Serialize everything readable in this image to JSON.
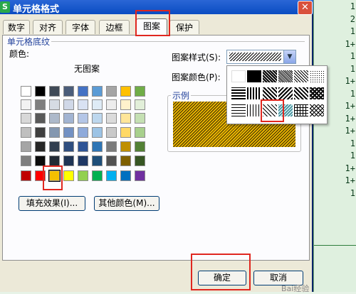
{
  "sheet": {
    "cells": [
      "1",
      "2",
      "1",
      "1+",
      "1",
      "1",
      "1+",
      "1",
      "1+",
      "1+",
      "1+",
      "1",
      "1",
      "1+",
      "1+",
      "1"
    ]
  },
  "dialog": {
    "title": "单元格格式",
    "app_icon": "S"
  },
  "tabs": [
    {
      "label": "数字"
    },
    {
      "label": "对齐"
    },
    {
      "label": "字体"
    },
    {
      "label": "边框"
    },
    {
      "label": "图案",
      "active": true
    },
    {
      "label": "保护"
    }
  ],
  "shading": {
    "group_label": "单元格底纹",
    "color_label": "颜色:",
    "no_pattern_label": "无图案",
    "selected_color": "#f5c000",
    "palette": [
      [
        "#ffffff",
        "#000000",
        "#404a57",
        "#4b5d7a",
        "#4472c4",
        "#5b9bd5",
        "#a5a5a5",
        "#ffc000",
        "#70ad47"
      ],
      [
        "#f2f2f2",
        "#7f7f7f",
        "#d6dce4",
        "#d0d8e8",
        "#d9e2f3",
        "#deebf6",
        "#ededed",
        "#fff2cc",
        "#e2efd9"
      ],
      [
        "#d8d8d8",
        "#595959",
        "#adb9ca",
        "#a2b4d2",
        "#b4c6e7",
        "#bdd7ee",
        "#dbdbdb",
        "#ffe699",
        "#c5e0b3"
      ],
      [
        "#bfbfbf",
        "#3f3f3f",
        "#8497b0",
        "#7391c3",
        "#8eaadb",
        "#9cc3e5",
        "#c9c9c9",
        "#ffd966",
        "#a8d08d"
      ],
      [
        "#a5a5a5",
        "#262626",
        "#323f4f",
        "#2f4e7f",
        "#2f5496",
        "#2e75b5",
        "#7b7b7b",
        "#bf8f00",
        "#538135"
      ],
      [
        "#7f7f7f",
        "#0c0c0c",
        "#222a35",
        "#1f3454",
        "#1f3864",
        "#1e4e79",
        "#525252",
        "#7f6000",
        "#375623"
      ],
      [
        "#c00000",
        "#ff0000",
        "#f5c000",
        "#ffff00",
        "#92d050",
        "#00b050",
        "#00b0f0",
        "#0070c0",
        "#7030a0"
      ]
    ],
    "fill_effect_button": "填充效果(I)...",
    "more_colors_button": "其他颜色(M)...",
    "pattern_style_label": "图案样式(S):",
    "pattern_color_label": "图案颜色(P):",
    "example_label": "示例",
    "example_fill_color": "#e8b400"
  },
  "pattern_popup": {
    "rows": [
      [
        "blank",
        "solid",
        "dense-75",
        "dense-50",
        "dense-25",
        "dots-fine"
      ],
      [
        "horizontal",
        "vertical",
        "rev-diagonal",
        "diagonal",
        "diagonal-cross",
        "thick-diag-cross"
      ],
      [
        "thin-horizontal",
        "thin-vertical",
        "thin-rev-diagonal",
        "thin-diagonal",
        "thin-grid",
        "thin-diag-grid"
      ]
    ],
    "selected": "thin-diagonal"
  },
  "footer": {
    "ok_button": "确定",
    "cancel_button": "取消",
    "watermark": "Bai经验"
  }
}
